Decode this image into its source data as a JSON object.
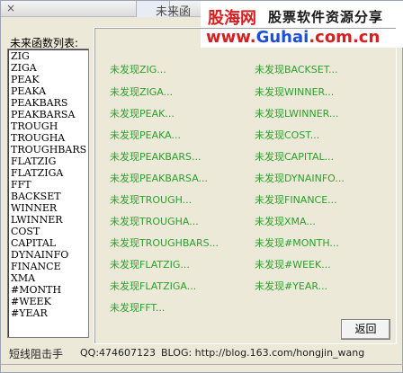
{
  "window": {
    "title": "未来函",
    "close_glyph": "×"
  },
  "watermark": {
    "logo_text": "股海网",
    "tagline": "股票软件资源分享",
    "url_prefix": "www.",
    "url_brand": "Guhai",
    "url_suffix": ".com.cn"
  },
  "function_list": {
    "label": "未来函数列表:",
    "items": [
      "ZIG",
      "ZIGA",
      "PEAK",
      "PEAKA",
      "PEAKBARS",
      "PEAKBARSA",
      "TROUGH",
      "TROUGHA",
      "TROUGHBARS",
      "FLATZIG",
      "FLATZIGA",
      "FFT",
      "BACKSET",
      "WINNER",
      "LWINNER",
      "COST",
      "CAPITAL",
      "DYNAINFO",
      "FINANCE",
      "XMA",
      "#MONTH",
      "#WEEK",
      "#YEAR"
    ]
  },
  "results": {
    "column1": [
      "未发现ZIG...",
      "未发现ZIGA...",
      "未发现PEAK...",
      "未发现PEAKA...",
      "未发现PEAKBARS...",
      "未发现PEAKBARSA...",
      "未发现TROUGH...",
      "未发现TROUGHA...",
      "未发现TROUGHBARS...",
      "未发现FLATZIG...",
      "未发现FLATZIGA...",
      "未发现FFT..."
    ],
    "column2": [
      "未发现BACKSET...",
      "未发现WINNER...",
      "未发现LWINNER...",
      "未发现COST...",
      "未发现CAPITAL...",
      "未发现DYNAINFO...",
      "未发现FINANCE...",
      "未发现XMA...",
      "未发现#MONTH...",
      "未发现#WEEK...",
      "未发现#YEAR..."
    ],
    "color": "#2aa12a"
  },
  "buttons": {
    "back_label": "返回"
  },
  "status_bar": {
    "author": "短线阻击手",
    "qq": "QQ:474607123",
    "blog": "BLOG: http://blog.163.com/hongjin_wang"
  },
  "colors": {
    "window_bg": "#ece9d8",
    "watermark_red": "#d81e1e",
    "watermark_blue": "#1e4fd8"
  }
}
